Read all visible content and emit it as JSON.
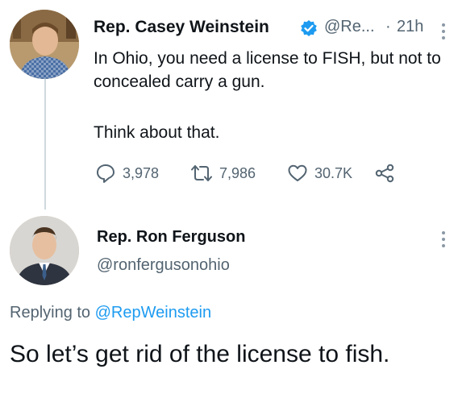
{
  "tweet": {
    "author_name": "Rep. Casey Weinstein",
    "author_handle": "@Re...",
    "separator": "·",
    "time": "21h",
    "verified_icon": "verified-badge-icon",
    "text_line1": "In Ohio, you need a license to FISH, but not to concealed carry a gun.",
    "text_line2": "Think about that.",
    "replies": "3,978",
    "retweets": "7,986",
    "likes": "30.7K",
    "accent_color": "#1d9bf0"
  },
  "reply": {
    "author_name": "Rep. Ron Ferguson",
    "author_handle": "@ronfergusonohio",
    "replying_prefix": "Replying to ",
    "replying_to": "@RepWeinstein",
    "text": "So let’s get rid of the license to fish."
  }
}
